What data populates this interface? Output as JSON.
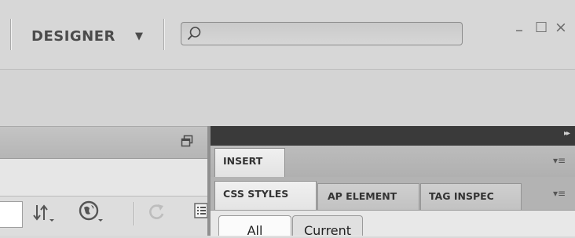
{
  "header": {
    "workspace_label": "DESIGNER",
    "workspace_caret": "▼",
    "search_placeholder": "",
    "window_controls": {
      "minimize": "–",
      "maximize": "□",
      "close": "×"
    }
  },
  "document_toolbar": {
    "icons": [
      "sort-arrows-icon",
      "globe-icon",
      "refresh-icon",
      "list-icon",
      "restore-window-icon"
    ]
  },
  "panels": {
    "collapse_glyph": "▸▸",
    "insert_group": {
      "tab_label": "INSERT",
      "menu_glyph": "▾≡"
    },
    "css_group": {
      "tabs": [
        "CSS STYLES",
        "AP ELEMENT",
        "TAG INSPEC"
      ],
      "menu_glyph": "▾≡",
      "modes": [
        "All",
        "Current"
      ]
    }
  },
  "colors": {
    "panel_dark": "#3a3a3a",
    "chrome": "#d7d7d7",
    "tab_active": "#ececec"
  }
}
